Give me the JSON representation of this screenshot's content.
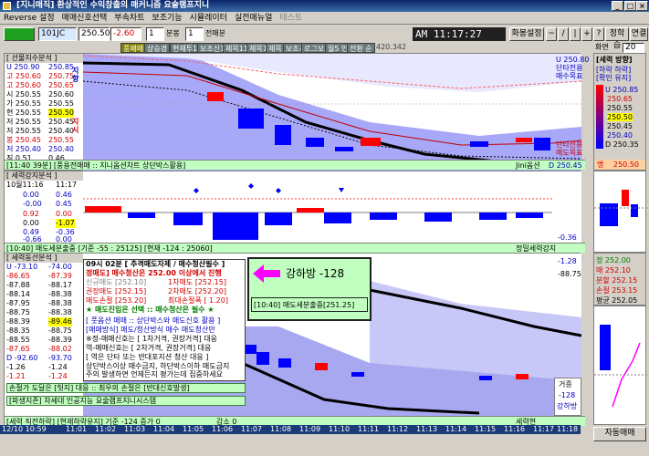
{
  "app": {
    "title": "[지니매직] 환상적인 수익창출의 매커니즘 요술램프지니"
  },
  "menu": [
    "Reverse 설정",
    "매매신호선택",
    "부속차트",
    "보조기능",
    "시뮬레이터",
    "실전매뉴얼",
    "테스트"
  ],
  "toolbar": {
    "code": "101JC",
    "price": "250.50",
    "change": "-2.60",
    "minutes": "1",
    "unit_label": "분봉",
    "days": "1",
    "days_label": "전매분",
    "tab_active": "풍매매",
    "time": "11:17:27",
    "tab_label": "화봉설정",
    "arrows": [
      "~",
      "/",
      "|",
      "+",
      "?"
    ],
    "right1": "정학습",
    "right2": "연결",
    "screen_label": "화면",
    "screen_no": "20",
    "price_small": "420.342"
  },
  "tabs": [
    "풍매매",
    "상승경",
    "현재투1",
    "보조신1",
    "제목11",
    "제목1",
    "제목",
    "보조지",
    "로그보지",
    "월5 인",
    "전환 순"
  ],
  "panel1": {
    "title": "[ 선물지수분석 ]",
    "footer": "[11:40 39분] [풍용전매매 :: 지니옵션차트 상단박스활용]",
    "footer_right": "Jini옵션",
    "close_label": "D 250.45",
    "right_top": "U 250.80",
    "right_sig1": "단타전용",
    "right_sig2": "매수목표",
    "right_sig3": "단타전용",
    "right_sig4": "매도목표",
    "side_label1": "지향",
    "side_label2": "지시"
  },
  "panel1_rows": [
    [
      "U",
      250.9,
      "250.85"
    ],
    [
      "고",
      250.6,
      "250.75"
    ],
    [
      "고",
      250.6,
      "250.65"
    ],
    [
      "시",
      250.55,
      "250.60"
    ],
    [
      "가",
      250.55,
      "250.55"
    ],
    [
      "현",
      250.55,
      "250.50"
    ],
    [
      "저",
      250.55,
      "250.45"
    ],
    [
      "저",
      250.55,
      "250.40"
    ],
    [
      "봉",
      250.45,
      "250.55"
    ],
    [
      "저",
      250.4,
      "250.40"
    ],
    [
      "직",
      0.51,
      "0.46"
    ]
  ],
  "direction_box": {
    "title": "[세력 방향]",
    "l1": "[하락 하락]",
    "l2": "[확인 유지]",
    "values": [
      "U 250.85",
      "250.65",
      "250.55",
      "250.50",
      "250.45",
      "250.40",
      "D 250.35"
    ],
    "bottom": "250.50",
    "bottom_label": "맹"
  },
  "panel2": {
    "title": "[ 세력강지분석 ]",
    "date": "10월11:16",
    "time": "11:17",
    "footer": "[10:40] 매도세분출중 [기준 -55 : 25125] [현재 -124 : 25060]",
    "footer_right": "정밀세력강지",
    "right_val": "-0.36"
  },
  "panel2_rows": [
    [
      "0.00",
      "0.46"
    ],
    [
      "-0.00",
      "0.45"
    ],
    [
      "0.92",
      "0.00"
    ],
    [
      "0.00",
      "-1.07"
    ],
    [
      "0.49",
      "-0.36"
    ],
    [
      "-0.66",
      "0.00"
    ]
  ],
  "panel3": {
    "title": "[ 세력동선분석 ]",
    "footer": "[세력 직전하락] [현재하락유지] 기준 -124 증가 0",
    "footer_right": "세력현",
    "footer_right2": "감소 0",
    "target1": "거죵",
    "target2": "-128",
    "target3": "강하방",
    "hi": "-1.28",
    "lo": "-88.75"
  },
  "panel3_rows": [
    [
      "U",
      "-73.10",
      "-74.00"
    ],
    [
      "",
      "-86.65",
      "-87.39"
    ],
    [
      "",
      "-87.88",
      "-88.17"
    ],
    [
      "",
      "-88.14",
      "-88.38"
    ],
    [
      "",
      "-87.95",
      "-88.38"
    ],
    [
      "",
      "-88.75",
      "-88.38"
    ],
    [
      "",
      "-88.39",
      "-89.46"
    ],
    [
      "",
      "-88.35",
      "-88.75"
    ],
    [
      "",
      "-88.55",
      "-88.39"
    ],
    [
      "",
      "-87.65",
      "-88.02"
    ],
    [
      "D",
      "-92.60",
      "-93.70"
    ],
    [
      "",
      "-1.26",
      "-1.24"
    ],
    [
      "",
      "-1.21",
      "-1.24"
    ],
    [
      "",
      "-1.26",
      "-1.25"
    ],
    [
      "",
      "-1.23",
      "-1.28"
    ]
  ],
  "overlay": {
    "line1": "09시 02분 [ 추격매도자제 / 매수청산필수 ]",
    "l2a": "정매도] 매수청산은 252.00 이상에서 진행",
    "l3a": "신규매도 [252.10]",
    "l3b": "1차매도 [252.15]",
    "l4a": "권장매도 [252.15]",
    "l4b": "2차매도 [252.20]",
    "l5a": "매도손절 [253.20]",
    "l5b": "최대손절폭 [ 1.20]",
    "l6": "★ 매도진입은 선택 :: 매수청산은 필수 ★",
    "sec": "[ 풋옵션 매매 :: 상단박스와 매도신호 활용 ]",
    "s1": "[매매방식] 매도/청산방식 매수 매도청산만",
    "s2": "※정-매매신호는 [ 1차거격, 권장거격] 대응",
    "s3": "역-매매신호는 [ 2차거격, 권장거격] 대응",
    "s4": "[ 역은 단타 또는 반대포지션 청산 대응 ]",
    "s5": "상단박스이상 매수금지, 하단박스이하 매도금지",
    "s6": "주의 발생하면 언제든지 평가는데 집중하세요",
    "warn": "손절가 도달은 [헛지] 대응 :: 최우의 손절은 [반대신호발생]",
    "system": "[파생지존] 차세대 인공지능 요술램프지니시스템",
    "callout": "강하방 -128",
    "callout2": "[10:40] 매도세분출중[251.25]"
  },
  "right_bottom": {
    "v1": "정 252.00",
    "v2": "매 252.10",
    "v3": "분할 252.15",
    "v4": "손절 253.15",
    "v5": "평균 252.05",
    "btn": "자동매매"
  },
  "times": [
    "12/10 10:59",
    "11:01",
    "11:02",
    "11:03",
    "11:04",
    "11:05",
    "11:06",
    "11:07",
    "11:08",
    "11:09",
    "11:10",
    "11:11",
    "11:12",
    "11:13",
    "11:14",
    "11:15",
    "11:16",
    "11:17",
    "11:18"
  ],
  "colors": {
    "bg_blue": "#9090f0",
    "candle_blue": "#0000ff",
    "candle_red": "#ff0000",
    "accent": "#ffff00"
  }
}
